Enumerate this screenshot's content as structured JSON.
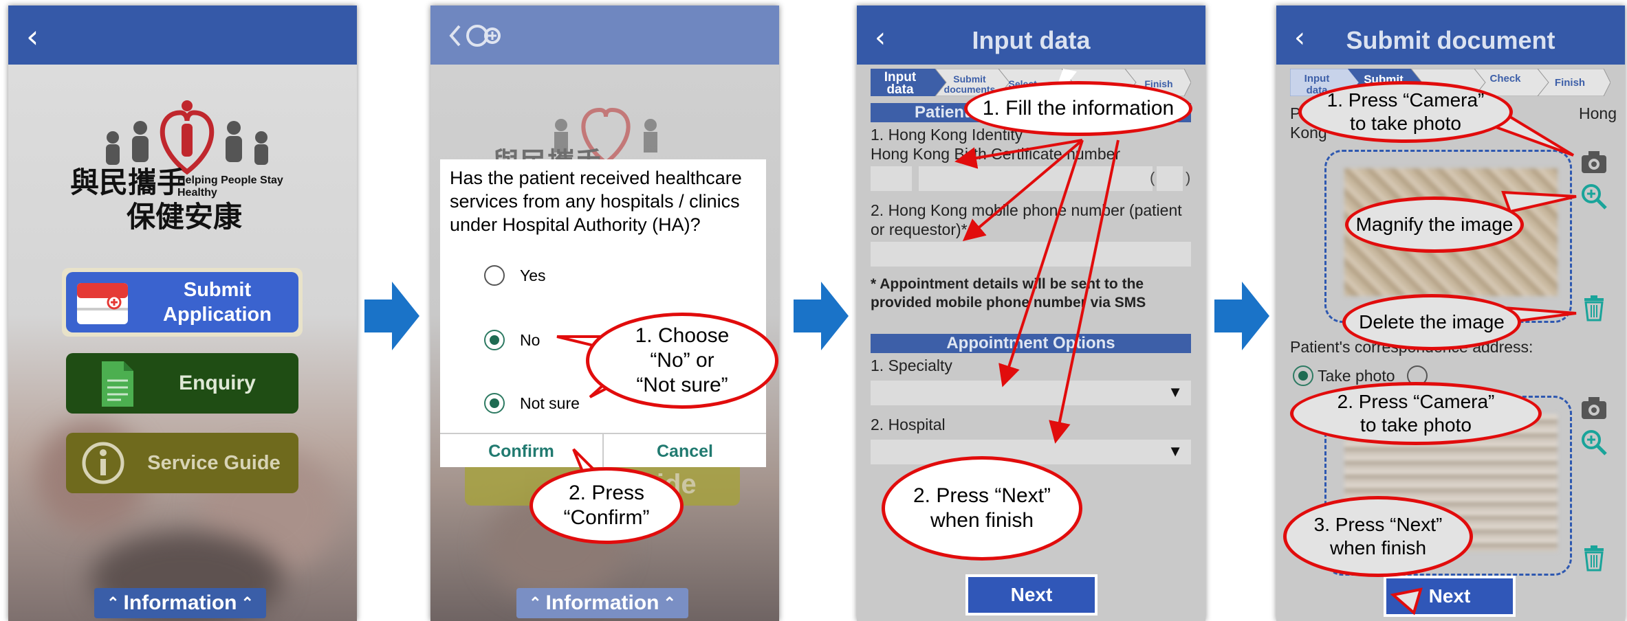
{
  "panel1": {
    "back_icon": "chevron-left-icon",
    "logo_zh_1": "與民攜手",
    "logo_zh_2": "保健安康",
    "logo_en": "Helping People Stay Healthy",
    "menu": [
      {
        "label": "Submit Application",
        "icon": "application-form-icon",
        "color": "#3a63cf"
      },
      {
        "label": "Enquiry",
        "icon": "document-icon",
        "color": "#1f4d14"
      },
      {
        "label": "Service Guide",
        "icon": "info-icon",
        "color": "#6f6a1d"
      }
    ],
    "info_label": "Information"
  },
  "panel2": {
    "question": "Has the patient received healthcare services from any hospitals / clinics under Hospital Authority (HA)?",
    "options": [
      {
        "label": "Yes",
        "selected": false
      },
      {
        "label": "No",
        "selected": true
      },
      {
        "label": "Not sure",
        "selected": true
      }
    ],
    "confirm": "Confirm",
    "cancel": "Cancel",
    "callout_choose": "1. Choose\n“No” or\n“Not sure”",
    "callout_confirm": "2. Press\n“Confirm”",
    "behind_button": "Service Guide",
    "behind_logo": "與民攜手",
    "info_label": "Information"
  },
  "panel3": {
    "title": "Input data",
    "steps": [
      "Input data",
      "Submit documents",
      "Select...",
      "",
      "Finish"
    ],
    "section_patient": "Patient",
    "field1": "1. Hong Kong Identity Card number or Hong Kong Birth Certificate number",
    "field1_visible_a": "1. Hong Kong Identity",
    "field1_visible_b": "Hong Kong Birth Certificate number",
    "field2": "2. Hong Kong mobile phone number (patient or requestor)*",
    "note": "* Appointment details will be sent to the provided mobile phone number via SMS",
    "section_appt": "Appointment Options",
    "specialty": "1. Specialty",
    "hospital": "2. Hospital",
    "next": "Next",
    "callout_fill": "1. Fill the information",
    "callout_next": "2. Press “Next”\nwhen finish"
  },
  "panel4": {
    "title": "Submit document",
    "steps": [
      "Input data",
      "Submit",
      "",
      "Check",
      "Finish"
    ],
    "doc_label_start": "P",
    "doc_label_end": "Hong",
    "doc_label_line2": "Kong",
    "correspondence_label": "Patient's correspondence address:",
    "take_photo_label": "Take photo",
    "callout_camera1": "1. Press “Camera”\nto take photo",
    "callout_magnify": "Magnify the image",
    "callout_delete": "Delete the image",
    "callout_camera2": "2. Press “Camera”\nto take photo",
    "callout_next": "3. Press “Next”\nwhen finish",
    "next": "Next"
  },
  "arrows": [
    "arrow-right-icon",
    "arrow-right-icon",
    "arrow-right-icon"
  ]
}
